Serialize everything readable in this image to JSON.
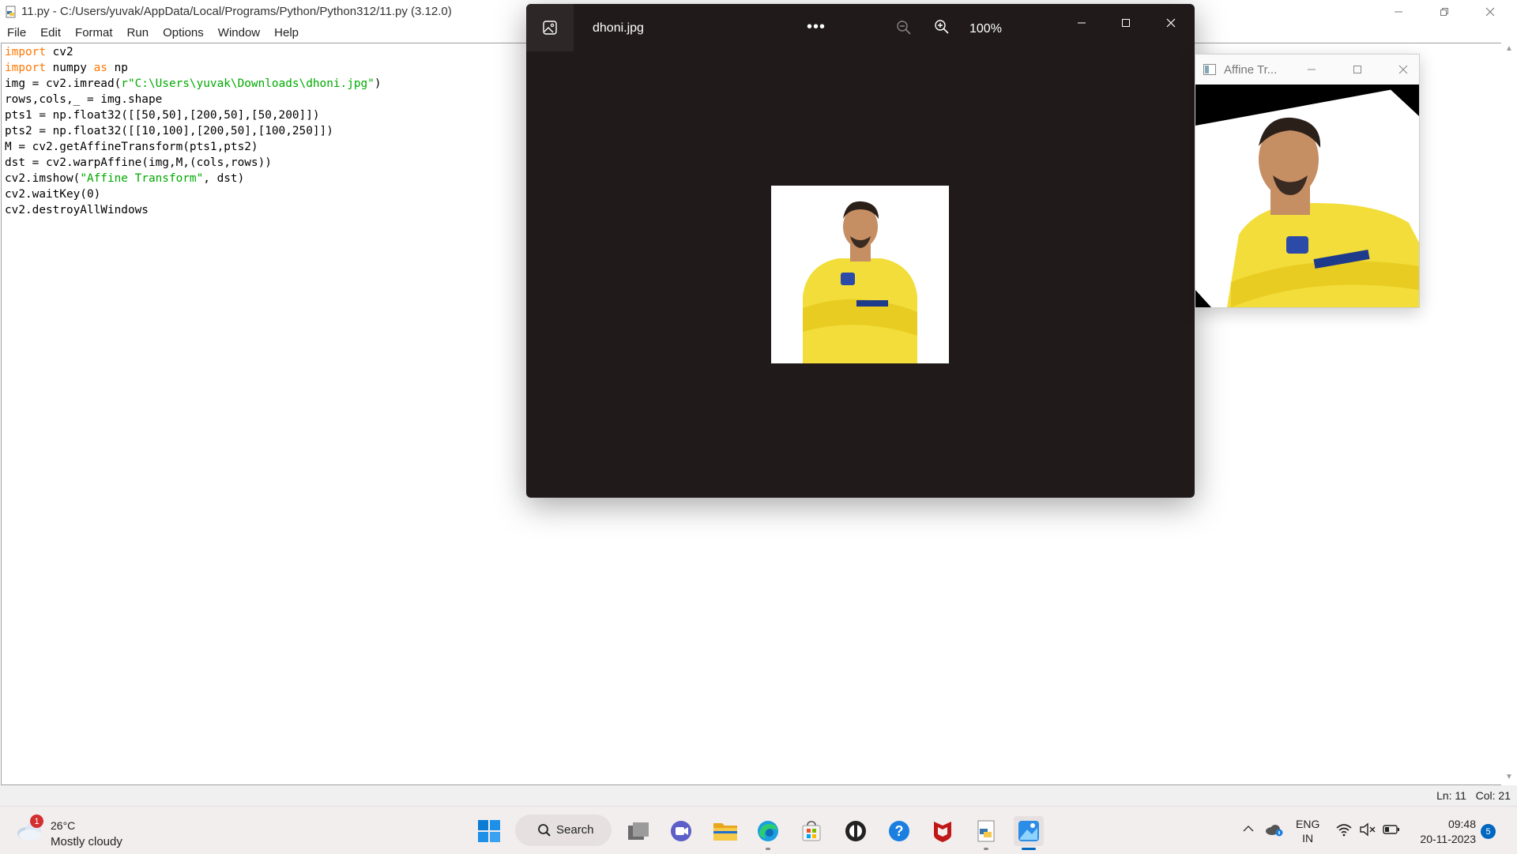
{
  "idle": {
    "title": "11.py - C:/Users/yuvak/AppData/Local/Programs/Python/Python312/11.py (3.12.0)",
    "menu": [
      "File",
      "Edit",
      "Format",
      "Run",
      "Options",
      "Window",
      "Help"
    ],
    "code": {
      "l1_kw": "import",
      "l1_rest": " cv2",
      "l2_kw1": "import",
      "l2_mid": " numpy ",
      "l2_kw2": "as",
      "l2_rest": " np",
      "l3_pre": "img = cv2.imread(",
      "l3_str": "r\"C:\\Users\\yuvak\\Downloads\\dhoni.jpg\"",
      "l3_post": ")",
      "l4": "rows,cols,_ = img.shape",
      "l5": "pts1 = np.float32([[50,50],[200,50],[50,200]])",
      "l6": "pts2 = np.float32([[10,100],[200,50],[100,250]])",
      "l7": "M = cv2.getAffineTransform(pts1,pts2)",
      "l8": "dst = cv2.warpAffine(img,M,(cols,rows))",
      "l9_pre": "cv2.imshow(",
      "l9_str": "\"Affine Transform\"",
      "l9_post": ", dst)",
      "l10": "cv2.waitKey(0)",
      "l11": "cv2.destroyAllWindows"
    },
    "status": {
      "line": "Ln: 11",
      "col": "Col: 21"
    }
  },
  "photos": {
    "filename": "dhoni.jpg",
    "more": "•••",
    "zoom": "100%"
  },
  "affine": {
    "title": "Affine Tr..."
  },
  "taskbar": {
    "weather": {
      "badge": "1",
      "temp": "26°C",
      "condition": "Mostly cloudy"
    },
    "search_label": "Search",
    "lang1": "ENG",
    "lang2": "IN",
    "time": "09:48",
    "date": "20-11-2023",
    "notifications": "5"
  },
  "colors": {
    "keyword": "#ff7700",
    "string": "#00aa00",
    "photos_bg": "#211a1a",
    "accent": "#0067c0"
  }
}
